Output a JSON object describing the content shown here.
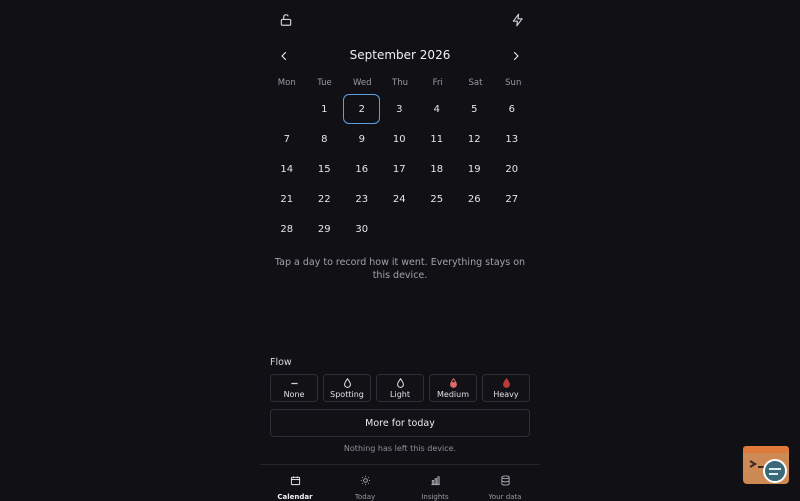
{
  "header": {
    "lock_icon": "lock-icon",
    "bolt_icon": "bolt-icon"
  },
  "calendar": {
    "month_title": "September 2026",
    "weekdays": [
      "Mon",
      "Tue",
      "Wed",
      "Thu",
      "Fri",
      "Sat",
      "Sun"
    ],
    "leading_blanks": 1,
    "days": [
      "1",
      "2",
      "3",
      "4",
      "5",
      "6",
      "7",
      "8",
      "9",
      "10",
      "11",
      "12",
      "13",
      "14",
      "15",
      "16",
      "17",
      "18",
      "19",
      "20",
      "21",
      "22",
      "23",
      "24",
      "25",
      "26",
      "27",
      "28",
      "29",
      "30"
    ],
    "selected_day": "2",
    "selected_color": "#5e9fe0"
  },
  "hint": "Tap a day to record how it went. Everything stays on this device.",
  "flow": {
    "label": "Flow",
    "options": [
      {
        "label": "None",
        "icon": "minus-icon"
      },
      {
        "label": "Spotting",
        "icon": "drop-outline-icon"
      },
      {
        "label": "Light",
        "icon": "drop-outline-icon"
      },
      {
        "label": "Medium",
        "icon": "drop-half-icon"
      },
      {
        "label": "Heavy",
        "icon": "drop-filled-icon"
      }
    ],
    "drop_color": "#e06a6a"
  },
  "more_button": "More for today",
  "footer_note": "Nothing has left this device.",
  "tabs": [
    {
      "label": "Calendar",
      "icon": "calendar-icon",
      "active": true
    },
    {
      "label": "Today",
      "icon": "sun-icon",
      "active": false
    },
    {
      "label": "Insights",
      "icon": "bar-chart-icon",
      "active": false
    },
    {
      "label": "Your data",
      "icon": "database-icon",
      "active": false
    }
  ]
}
